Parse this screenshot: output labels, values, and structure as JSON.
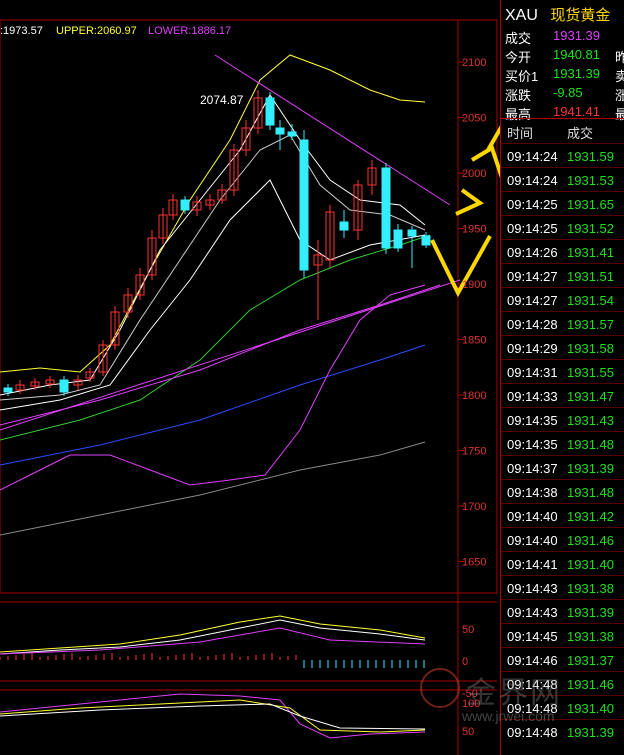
{
  "indicators": {
    "mid": ":1973.57",
    "upper": "UPPER:2060.97",
    "lower": "LOWER:1886.17"
  },
  "chart": {
    "peak_label": "2074.87",
    "price_axis": [
      "2100",
      "2050",
      "2000",
      "1950",
      "1900",
      "1850",
      "1800",
      "1750",
      "1700",
      "1650"
    ],
    "macd_axis": [
      "50",
      "0",
      "-50"
    ],
    "kdj_axis": [
      "100",
      "50"
    ]
  },
  "quote": {
    "code": "XAU",
    "name": "现货黄金",
    "rows": [
      {
        "label": "成交",
        "value": "1931.39",
        "color": "#e040fb",
        "extra": ""
      },
      {
        "label": "今开",
        "value": "1940.81",
        "color": "#1ee01e",
        "extra": "昨"
      },
      {
        "label": "买价1",
        "value": "1931.39",
        "color": "#1ee01e",
        "extra": "卖"
      },
      {
        "label": "涨跌",
        "value": "-9.85",
        "color": "#1ee01e",
        "extra": "涨"
      },
      {
        "label": "最高",
        "value": "1941.41",
        "color": "#ff3333",
        "extra": "最"
      }
    ]
  },
  "ticks": {
    "header_time": "时间",
    "header_trade": "成交",
    "rows": [
      {
        "time": "09:14:24",
        "price": "1931.59"
      },
      {
        "time": "09:14:24",
        "price": "1931.53"
      },
      {
        "time": "09:14:25",
        "price": "1931.65"
      },
      {
        "time": "09:14:25",
        "price": "1931.52"
      },
      {
        "time": "09:14:26",
        "price": "1931.41"
      },
      {
        "time": "09:14:27",
        "price": "1931.51"
      },
      {
        "time": "09:14:27",
        "price": "1931.54"
      },
      {
        "time": "09:14:28",
        "price": "1931.57"
      },
      {
        "time": "09:14:29",
        "price": "1931.58"
      },
      {
        "time": "09:14:31",
        "price": "1931.55"
      },
      {
        "time": "09:14:33",
        "price": "1931.47"
      },
      {
        "time": "09:14:35",
        "price": "1931.43"
      },
      {
        "time": "09:14:35",
        "price": "1931.48"
      },
      {
        "time": "09:14:37",
        "price": "1931.39"
      },
      {
        "time": "09:14:38",
        "price": "1931.48"
      },
      {
        "time": "09:14:40",
        "price": "1931.42"
      },
      {
        "time": "09:14:40",
        "price": "1931.46"
      },
      {
        "time": "09:14:41",
        "price": "1931.40"
      },
      {
        "time": "09:14:43",
        "price": "1931.38"
      },
      {
        "time": "09:14:43",
        "price": "1931.39"
      },
      {
        "time": "09:14:45",
        "price": "1931.38"
      },
      {
        "time": "09:14:46",
        "price": "1931.37"
      },
      {
        "time": "09:14:48",
        "price": "1931.46"
      },
      {
        "time": "09:14:48",
        "price": "1931.40"
      },
      {
        "time": "09:14:48",
        "price": "1931.39"
      }
    ]
  },
  "watermark": {
    "text": "金界网",
    "url": "www.jrwei.com"
  },
  "colors": {
    "bull": "#ff3333",
    "bear": "#33eeff",
    "upper": "#ffff33",
    "lower": "#e040fb"
  }
}
